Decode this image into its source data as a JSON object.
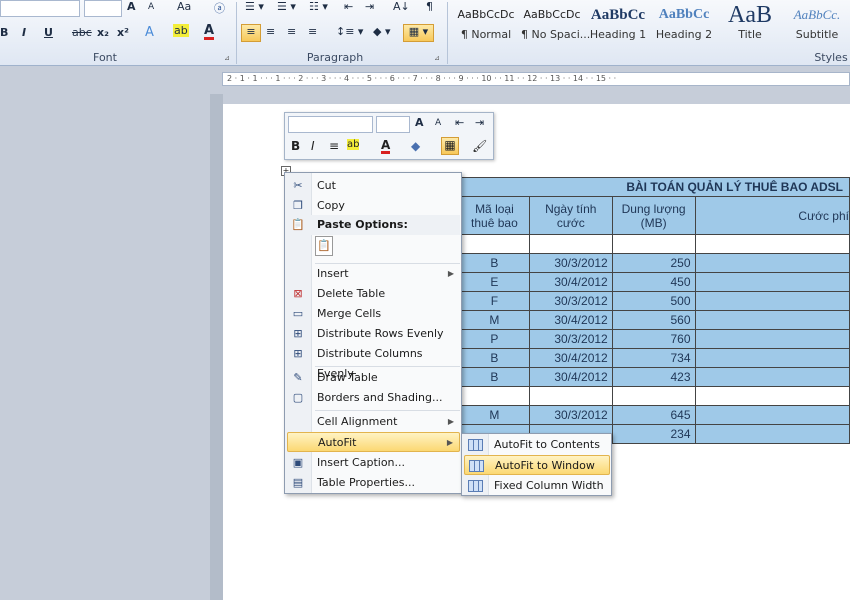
{
  "ribbon": {
    "font_group": "Font",
    "paragraph_group": "Paragraph",
    "styles_group": "Styles",
    "font_buttons": [
      "B",
      "I",
      "U",
      "abc",
      "x₂",
      "x²",
      "A",
      "ab",
      "A"
    ],
    "grow_font": "A",
    "shrink_font": "A",
    "change_case": "Aa",
    "show_marks": "¶",
    "sort": "A↓",
    "styles": [
      {
        "sample": "AaBbCcDc",
        "name": "¶ Normal"
      },
      {
        "sample": "AaBbCcDc",
        "name": "¶ No Spaci..."
      },
      {
        "sample": "AaBbCc",
        "name": "Heading 1"
      },
      {
        "sample": "AaBbCc",
        "name": "Heading 2"
      },
      {
        "sample": "AaB",
        "name": "Title"
      },
      {
        "sample": "AaBbCc.",
        "name": "Subtitle"
      }
    ]
  },
  "ruler": {
    "text": "2 · 1 · 1 · · · 1 · · · 2 · · · 3 · · · 4 · · · 5 · · · 6 · · · 7 · · · 8 · · · 9 · · · 10 · · 11 · · 12 · · 13 · · 14 · · 15 · ·"
  },
  "mini_toolbar": {
    "bold": "B",
    "italic": "I",
    "center": "≡",
    "highlight": "ab",
    "font_color": "A",
    "shading": "◆",
    "borders": "▦",
    "format_painter": "🖌",
    "grow": "A",
    "shrink": "A"
  },
  "table": {
    "title": "BÀI TOÁN QUẢN LÝ THUÊ BAO ADSL",
    "headers": [
      "Mã loại thuê bao",
      "Ngày tính cước",
      "Dung lượng (MB)",
      "Cước phí"
    ],
    "rows": [
      [
        "B",
        "30/3/2012",
        "250"
      ],
      [
        "E",
        "30/4/2012",
        "450"
      ],
      [
        "F",
        "30/3/2012",
        "500"
      ],
      [
        "M",
        "30/4/2012",
        "560"
      ],
      [
        "P",
        "30/3/2012",
        "760"
      ],
      [
        "B",
        "30/4/2012",
        "734"
      ],
      [
        "B",
        "30/4/2012",
        "423"
      ],
      [
        "M",
        "30/3/2012",
        "645"
      ],
      [
        "",
        "",
        "234"
      ]
    ]
  },
  "context_menu": {
    "cut": "Cut",
    "copy": "Copy",
    "paste_options": "Paste Options:",
    "insert": "Insert",
    "delete_table": "Delete Table",
    "merge_cells": "Merge Cells",
    "distribute_rows": "Distribute Rows Evenly",
    "distribute_columns": "Distribute Columns Evenly",
    "draw_table": "Draw Table",
    "borders_shading": "Borders and Shading...",
    "cell_alignment": "Cell Alignment",
    "autofit": "AutoFit",
    "insert_caption": "Insert Caption...",
    "table_properties": "Table Properties..."
  },
  "autofit_submenu": {
    "contents": "AutoFit to Contents",
    "window": "AutoFit to Window",
    "fixed": "Fixed Column Width"
  },
  "colors": {
    "highlight": "#fbd873",
    "table_fill": "#9fc9e8",
    "ribbon": "#dfe7f3"
  }
}
